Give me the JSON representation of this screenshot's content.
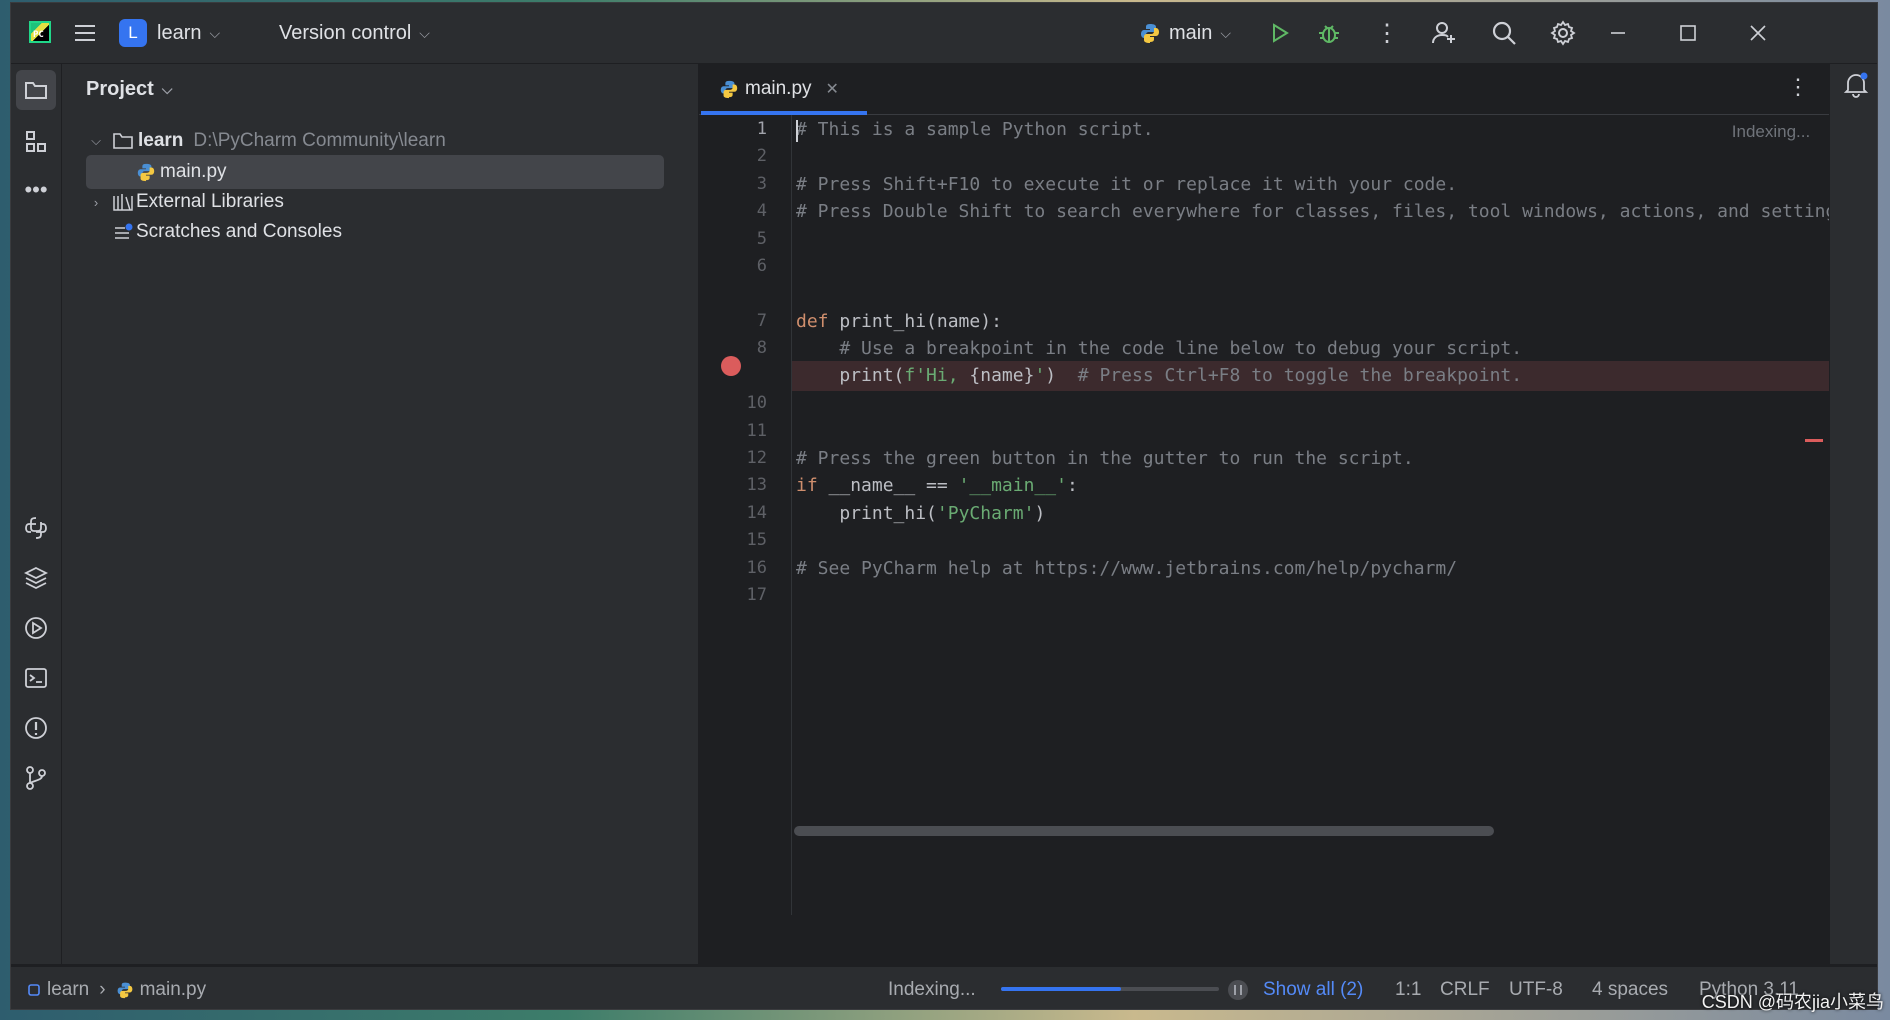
{
  "titlebar": {
    "logo_text": "PC",
    "project_badge": "L",
    "project_name": "learn",
    "vcs_label": "Version control",
    "run_config": "main"
  },
  "project_panel": {
    "header": "Project",
    "tree": [
      {
        "label": "learn",
        "path": "D:\\PyCharm Community\\learn"
      },
      {
        "label": "main.py"
      },
      {
        "label": "External Libraries"
      },
      {
        "label": "Scratches and Consoles"
      }
    ]
  },
  "editor": {
    "tab_label": "main.py",
    "indexing_hint": "Indexing...",
    "line_numbers": [
      "1",
      "2",
      "3",
      "4",
      "5",
      "6",
      "7",
      "8",
      "",
      "10",
      "11",
      "12",
      "13",
      "14",
      "15",
      "16",
      "17"
    ],
    "lines": {
      "l1": "# This is a sample Python script.",
      "l3": "# Press Shift+F10 to execute it or replace it with your code.",
      "l4": "# Press Double Shift to search everywhere for classes, files, tool windows, actions, and settings.",
      "l7_kw": "def",
      "l7_rest": " print_hi(name):",
      "l8": "    # Use a breakpoint in the code line below to debug your script.",
      "l9_a": "    print(",
      "l9_str1": "f'Hi, ",
      "l9_mid": "{name}",
      "l9_str2": "'",
      "l9_b": ")  ",
      "l9_cm": "# Press Ctrl+F8 to toggle the breakpoint.",
      "l12": "# Press the green button in the gutter to run the script.",
      "l13_kw": "if",
      "l13_mid": " __name__ == ",
      "l13_str": "'__main__'",
      "l13_end": ":",
      "l14_a": "    print_hi(",
      "l14_str": "'PyCharm'",
      "l14_b": ")",
      "l16": "# See PyCharm help at https://www.jetbrains.com/help/pycharm/"
    }
  },
  "statusbar": {
    "crumb_project": "learn",
    "crumb_file": "main.py",
    "indexing": "Indexing...",
    "progress": 0.55,
    "show_all": "Show all (2)",
    "position": "1:1",
    "line_sep": "CRLF",
    "encoding": "UTF-8",
    "indent": "4 spaces",
    "interpreter": "Python 3.11"
  },
  "watermark": "CSDN @码农jia小菜鸟",
  "colors": {
    "accent": "#3574f0",
    "breakpoint": "#db5c5c",
    "run_green": "#5fb865"
  }
}
